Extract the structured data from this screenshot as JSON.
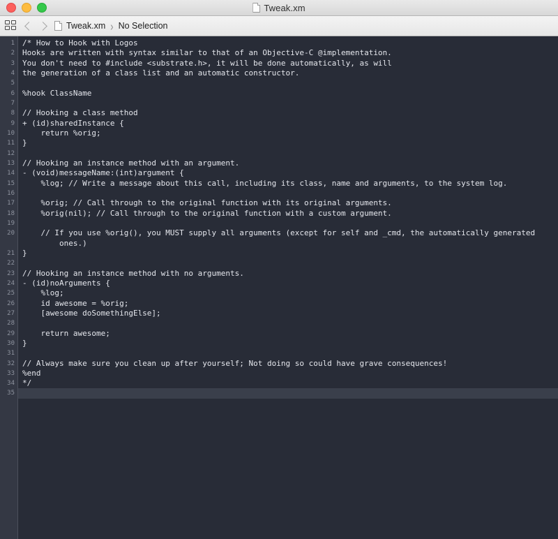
{
  "window": {
    "title": "Tweak.xm",
    "title_icon": "document-icon",
    "controls": [
      {
        "name": "close-button",
        "color": "#fc605c"
      },
      {
        "name": "minimize-button",
        "color": "#fdbc40"
      },
      {
        "name": "maximize-button",
        "color": "#34c84a"
      }
    ]
  },
  "toolbar": {
    "panel_toggle_icon": "grid-panels-icon",
    "back_icon": "chevron-left-icon",
    "forward_icon": "chevron-right-icon",
    "breadcrumb": {
      "file_icon": "document-icon",
      "file": "Tweak.xm",
      "separator": "›",
      "selection": "No Selection"
    }
  },
  "editor": {
    "current_line": 35,
    "colors": {
      "background": "#282c37",
      "gutter_background": "#343844",
      "gutter_text": "#8e939f",
      "text": "#e4e6ec",
      "current_line_highlight": "#3a3f4b"
    },
    "line_numbers": [
      1,
      2,
      3,
      4,
      5,
      6,
      7,
      8,
      9,
      10,
      11,
      12,
      13,
      14,
      15,
      16,
      17,
      18,
      19,
      20,
      21,
      22,
      23,
      24,
      25,
      26,
      27,
      28,
      29,
      30,
      31,
      32,
      33,
      34,
      35
    ],
    "lines": [
      "/* How to Hook with Logos",
      "Hooks are written with syntax similar to that of an Objective-C @implementation.",
      "You don't need to #include <substrate.h>, it will be done automatically, as will",
      "the generation of a class list and an automatic constructor.",
      "",
      "%hook ClassName",
      "",
      "// Hooking a class method",
      "+ (id)sharedInstance {",
      "    return %orig;",
      "}",
      "",
      "// Hooking an instance method with an argument.",
      "- (void)messageName:(int)argument {",
      "    %log; // Write a message about this call, including its class, name and arguments, to the system log.",
      "",
      "    %orig; // Call through to the original function with its original arguments.",
      "    %orig(nil); // Call through to the original function with a custom argument.",
      "",
      "    // If you use %orig(), you MUST supply all arguments (except for self and _cmd, the automatically generated",
      "        ones.)",
      "}",
      "",
      "// Hooking an instance method with no arguments.",
      "- (id)noArguments {",
      "    %log;",
      "    id awesome = %orig;",
      "    [awesome doSomethingElse];",
      "",
      "    return awesome;",
      "}",
      "",
      "// Always make sure you clean up after yourself; Not doing so could have grave consequences!",
      "%end",
      "*/",
      ""
    ]
  }
}
